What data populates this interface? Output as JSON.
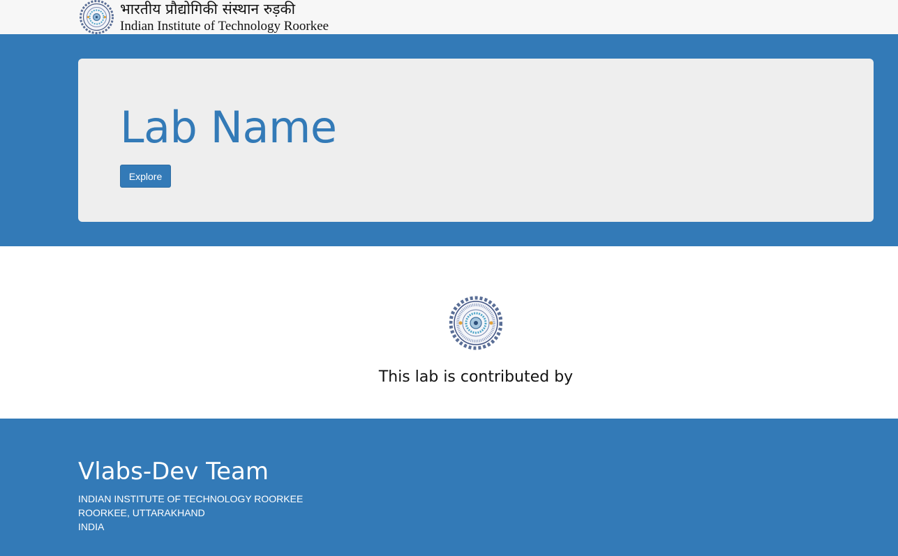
{
  "header": {
    "logo_icon": "iit-roorkee-emblem-icon",
    "title_hindi": "भारतीय प्रौद्योगिकी संस्थान रुड़की",
    "title_english": "Indian Institute of Technology Roorkee"
  },
  "hero": {
    "lab_name": "Lab Name",
    "explore_label": "Explore"
  },
  "contribution": {
    "logo_icon": "iit-roorkee-emblem-icon",
    "text": "This lab is contributed by"
  },
  "footer": {
    "team": "Vlabs-Dev Team",
    "address": [
      "INDIAN INSTITUTE OF TECHNOLOGY ROORKEE",
      "ROORKEE, UTTARAKHAND",
      "INDIA"
    ]
  },
  "colors": {
    "primary": "#337ab7",
    "jumbotron_bg": "#eeeeee",
    "topbar_bg": "#f7f7f7"
  }
}
